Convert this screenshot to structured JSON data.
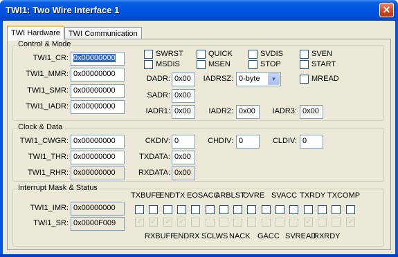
{
  "window": {
    "title": "TWI1: Two Wire Interface 1",
    "close_glyph": "✕"
  },
  "tabs": [
    {
      "label": "TWI Hardware"
    },
    {
      "label": "TWI Communication"
    }
  ],
  "control_mode": {
    "title": "Control & Mode",
    "cr": {
      "label": "TWI1_CR:",
      "value": "0x00000000"
    },
    "mmr": {
      "label": "TWI1_MMR:",
      "value": "0x00000000"
    },
    "smr": {
      "label": "TWI1_SMR:",
      "value": "0x00000000"
    },
    "iadr": {
      "label": "TWI1_IADR:",
      "value": "0x00000000"
    },
    "flags": {
      "swrst": "SWRST",
      "quick": "QUICK",
      "svdis": "SVDIS",
      "sven": "SVEN",
      "msdis": "MSDIS",
      "msen": "MSEN",
      "stop": "STOP",
      "start": "START",
      "mread": "MREAD"
    },
    "dadr": {
      "label": "DADR:",
      "value": "0x00"
    },
    "iadrsz": {
      "label": "IADRSZ:",
      "value": "0-byte"
    },
    "sadr": {
      "label": "SADR:",
      "value": "0x00"
    },
    "iadr1": {
      "label": "IADR1:",
      "value": "0x00"
    },
    "iadr2": {
      "label": "IADR2:",
      "value": "0x00"
    },
    "iadr3": {
      "label": "IADR3:",
      "value": "0x00"
    }
  },
  "clock_data": {
    "title": "Clock & Data",
    "cwgr": {
      "label": "TWI1_CWGR:",
      "value": "0x00000000"
    },
    "thr": {
      "label": "TWI1_THR:",
      "value": "0x00000000"
    },
    "rhr": {
      "label": "TWI1_RHR:",
      "value": "0x00000000"
    },
    "ckdiv": {
      "label": "CKDIV:",
      "value": "0"
    },
    "chdiv": {
      "label": "CHDIV:",
      "value": "0"
    },
    "cldiv": {
      "label": "CLDIV:",
      "value": "0"
    },
    "txdata": {
      "label": "TXDATA:",
      "value": "0x00"
    },
    "rxdata": {
      "label": "RXDATA:",
      "value": "0x00"
    }
  },
  "interrupt": {
    "title": "Interrupt Mask & Status",
    "imr": {
      "label": "TWI1_IMR:",
      "value": "0x00000000"
    },
    "sr": {
      "label": "TWI1_SR:",
      "value": "0x0000F009"
    },
    "top_labels": [
      "TXBUFE",
      "ENDTX",
      "EOSACC",
      "ARBLST",
      "OVRE",
      "SVACC",
      "TXRDY",
      "TXCOMP"
    ],
    "bottom_labels": [
      "RXBUFF",
      "ENDRX",
      "SCLWS",
      "NACK",
      "GACC",
      "SVREAD",
      "RXRDY"
    ],
    "sr_checked": [
      true,
      true,
      true,
      true,
      false,
      false,
      false,
      false,
      false,
      false,
      false,
      false,
      true,
      false,
      false,
      true
    ]
  }
}
